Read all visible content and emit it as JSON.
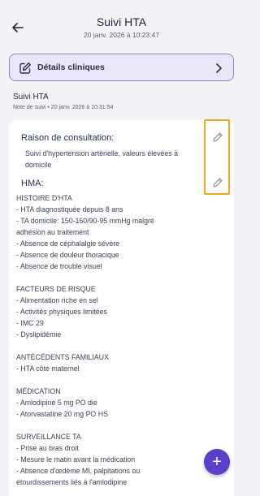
{
  "header": {
    "title": "Suivi HTA",
    "datetime": "20 janv. 2026 à 10:23:47"
  },
  "details_card": {
    "label": "Détails cliniques"
  },
  "note": {
    "title": "Suivi HTA",
    "meta": "Note de suivi • 20 janv. 2026 à 10:31:54"
  },
  "sections": {
    "consultation_title": "Raison de consultation:",
    "consultation_text": "Suivi d'hypertension artérielle, valeurs élevées à domicile",
    "hma_title": "HMA:"
  },
  "hma_lines": [
    "HISTOIRE D'HTA",
    "- HTA diagnostiquée depuis 8 ans",
    "- TA domicile: 150-160/90-95 mmHg malgré",
    "adhésion au traitement",
    "- Absence de céphalalgie sévère",
    "- Absence de douleur thoracique",
    "- Absence de trouble visuel",
    "",
    "FACTEURS DE RISQUE",
    "- Alimentation riche en sel",
    "- Activités physiques limitées",
    "- IMC 29",
    "- Dyslipidémie",
    "",
    "ANTÉCÉDENTS FAMILIAUX",
    "- HTA côté maternel",
    "",
    "MÉDICATION",
    "- Amlodipine 5 mg PO die",
    "- Atorvastatine 20 mg PO HS",
    "",
    "SURVEILLANCE TA",
    "- Prise au bras droit",
    "- Mesure le matin avant la médication",
    "- Absence d'œdème MI, palpitations ou",
    "étourdissements liés à l'amlodipine"
  ],
  "icons": {
    "back": "arrow-left-icon",
    "details": "edit-square-icon",
    "chevron": "chevron-right-icon",
    "edit": "pencil-icon",
    "fab": "plus-icon"
  },
  "colors": {
    "accent": "#5b3fc9",
    "card_bg": "#e9e6f8",
    "card_border": "#8d7fd4",
    "highlight": "#f0a81c",
    "page_bg": "#f3f3f7"
  }
}
